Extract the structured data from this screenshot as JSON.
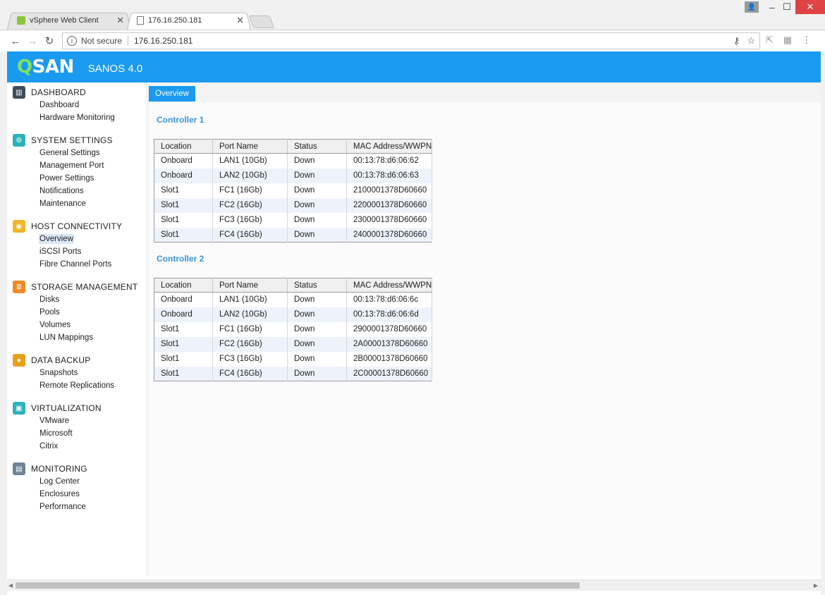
{
  "browser": {
    "tabs": [
      {
        "label": "vSphere Web Client",
        "icon": "vsphere-icon"
      },
      {
        "label": "176.16.250.181",
        "icon": "page-icon"
      }
    ],
    "security_label": "Not secure",
    "url": "176.16.250.181"
  },
  "app": {
    "logo_q": "Q",
    "logo_rest": "SAN",
    "version": "SANOS 4.0",
    "accent_color": "#1a9af1"
  },
  "sidebar": {
    "groups": [
      {
        "heading": "DASHBOARD",
        "icon": "dashboard-icon",
        "items": [
          "Dashboard",
          "Hardware Monitoring"
        ]
      },
      {
        "heading": "SYSTEM SETTINGS",
        "icon": "settings-icon",
        "items": [
          "General Settings",
          "Management Port",
          "Power Settings",
          "Notifications",
          "Maintenance"
        ]
      },
      {
        "heading": "HOST CONNECTIVITY",
        "icon": "host-connectivity-icon",
        "items": [
          "Overview",
          "iSCSI Ports",
          "Fibre Channel Ports"
        ]
      },
      {
        "heading": "STORAGE MANAGEMENT",
        "icon": "storage-icon",
        "items": [
          "Disks",
          "Pools",
          "Volumes",
          "LUN Mappings"
        ]
      },
      {
        "heading": "DATA BACKUP",
        "icon": "backup-icon",
        "items": [
          "Snapshots",
          "Remote Replications"
        ]
      },
      {
        "heading": "VIRTUALIZATION",
        "icon": "virtualization-icon",
        "items": [
          "VMware",
          "Microsoft",
          "Citrix"
        ]
      },
      {
        "heading": "MONITORING",
        "icon": "monitoring-icon",
        "items": [
          "Log Center",
          "Enclosures",
          "Performance"
        ]
      }
    ],
    "selected_item": "Overview"
  },
  "main": {
    "tab_label": "Overview",
    "columns": [
      "Location",
      "Port Name",
      "Status",
      "MAC Address/WWPN"
    ],
    "controllers": [
      {
        "title": "Controller 1",
        "rows": [
          [
            "Onboard",
            "LAN1 (10Gb)",
            "Down",
            "00:13:78:d6:06:62"
          ],
          [
            "Onboard",
            "LAN2 (10Gb)",
            "Down",
            "00:13:78:d6:06:63"
          ],
          [
            "Slot1",
            "FC1 (16Gb)",
            "Down",
            "2100001378D60660"
          ],
          [
            "Slot1",
            "FC2 (16Gb)",
            "Down",
            "2200001378D60660"
          ],
          [
            "Slot1",
            "FC3 (16Gb)",
            "Down",
            "2300001378D60660"
          ],
          [
            "Slot1",
            "FC4 (16Gb)",
            "Down",
            "2400001378D60660"
          ]
        ]
      },
      {
        "title": "Controller 2",
        "rows": [
          [
            "Onboard",
            "LAN1 (10Gb)",
            "Down",
            "00:13:78:d6:06:6c"
          ],
          [
            "Onboard",
            "LAN2 (10Gb)",
            "Down",
            "00:13:78:d6:06:6d"
          ],
          [
            "Slot1",
            "FC1 (16Gb)",
            "Down",
            "2900001378D60660"
          ],
          [
            "Slot1",
            "FC2 (16Gb)",
            "Down",
            "2A00001378D60660"
          ],
          [
            "Slot1",
            "FC3 (16Gb)",
            "Down",
            "2B00001378D60660"
          ],
          [
            "Slot1",
            "FC4 (16Gb)",
            "Down",
            "2C00001378D60660"
          ]
        ]
      }
    ]
  }
}
